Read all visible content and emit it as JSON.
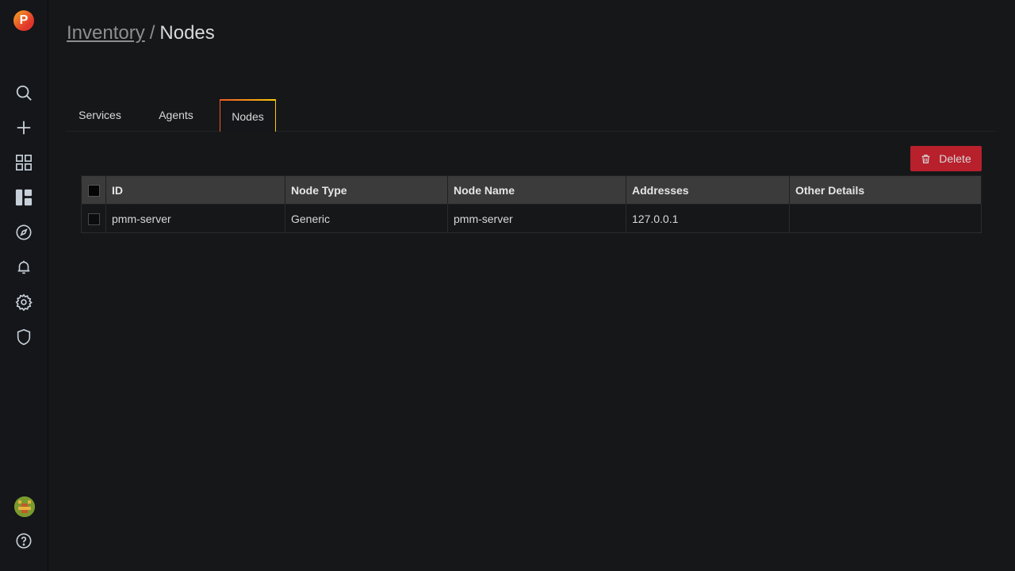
{
  "sidebar": {
    "logo_letter": "P",
    "icons": [
      "search-icon",
      "plus-icon",
      "dashboards-icon",
      "manage-icon",
      "explore-icon",
      "alerting-icon",
      "configuration-icon",
      "server-admin-icon"
    ],
    "bottom_icons": [
      "avatar",
      "help-icon"
    ]
  },
  "breadcrumb": {
    "parent": "Inventory",
    "separator": "/",
    "current": "Nodes"
  },
  "tabs": [
    {
      "label": "Services",
      "active": false
    },
    {
      "label": "Agents",
      "active": false
    },
    {
      "label": "Nodes",
      "active": true
    }
  ],
  "actions": {
    "delete_label": "Delete"
  },
  "table": {
    "columns": [
      "ID",
      "Node Type",
      "Node Name",
      "Addresses",
      "Other Details"
    ],
    "rows": [
      {
        "id": "pmm-server",
        "node_type": "Generic",
        "node_name": "pmm-server",
        "addresses": "127.0.0.1",
        "other_details": ""
      }
    ]
  },
  "colors": {
    "background": "#161719",
    "sidebar": "#141619",
    "danger": "#b8202c",
    "tab_accent_start": "#f05a28",
    "tab_accent_end": "#fbca0a"
  }
}
